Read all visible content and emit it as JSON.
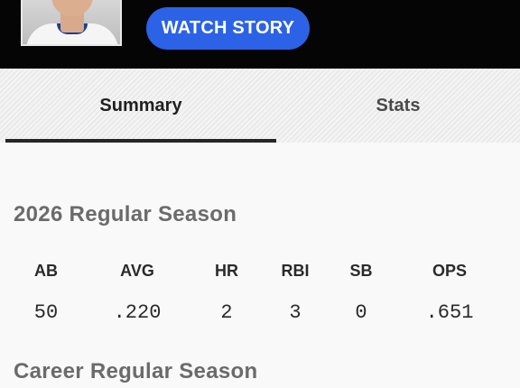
{
  "hero": {
    "watch_story_label": "WATCH STORY"
  },
  "tabs": [
    {
      "label": "Summary",
      "active": true
    },
    {
      "label": "Stats",
      "active": false
    }
  ],
  "season": {
    "title": "2026 Regular Season",
    "stats": [
      {
        "header": "AB",
        "value": "50"
      },
      {
        "header": "AVG",
        "value": ".220"
      },
      {
        "header": "HR",
        "value": "2"
      },
      {
        "header": "RBI",
        "value": "3"
      },
      {
        "header": "SB",
        "value": "0"
      },
      {
        "header": "OPS",
        "value": ".651"
      }
    ]
  },
  "career": {
    "title": "Career Regular Season"
  },
  "colors": {
    "hero_background": "#050505",
    "button_blue": "#2b62e6",
    "tab_underline": "#262626",
    "section_title": "#6b6b6b"
  }
}
